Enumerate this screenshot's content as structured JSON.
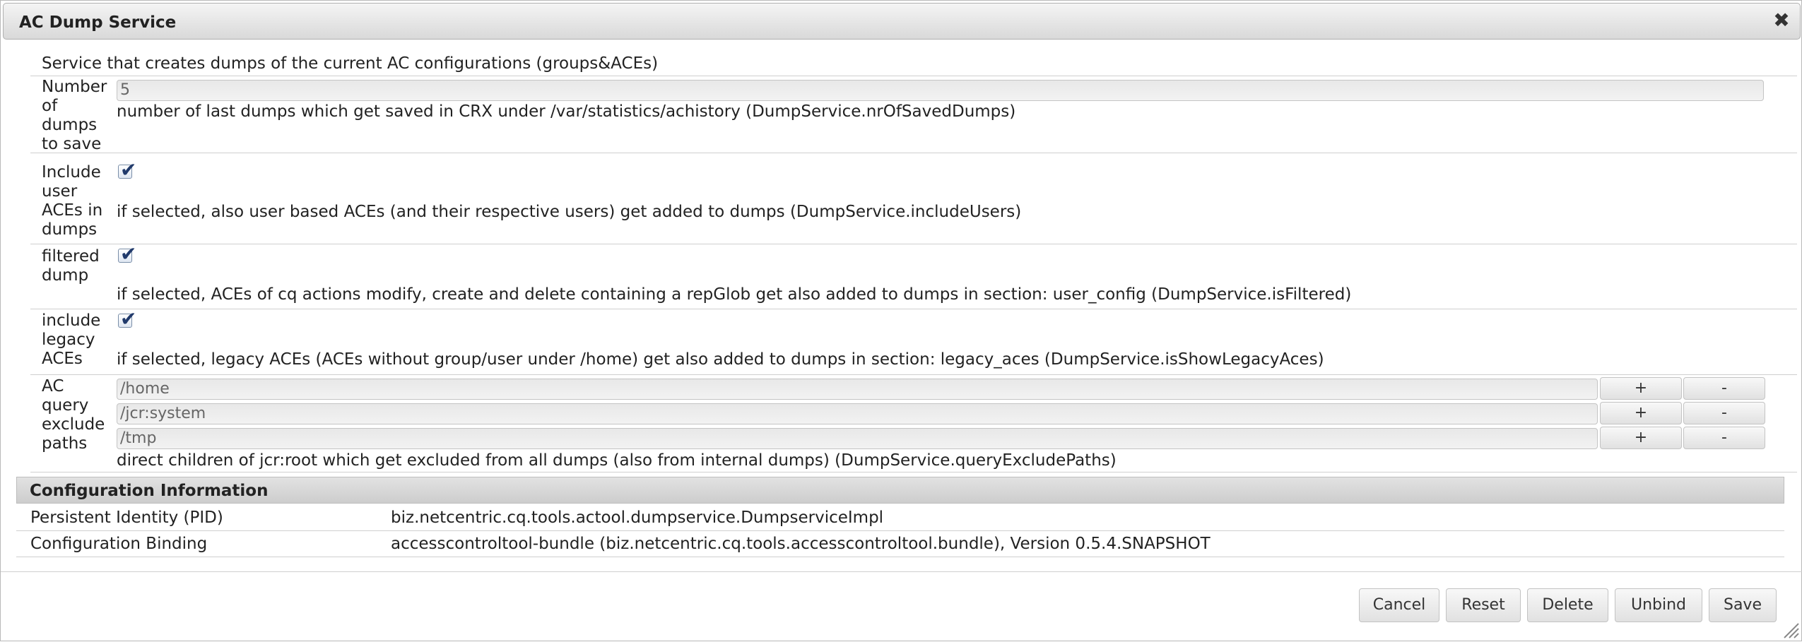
{
  "dialog": {
    "title": "AC Dump Service",
    "close_icon": "close-icon"
  },
  "description": "Service that creates dumps of the current AC configurations (groups&ACEs)",
  "fields": {
    "nr_dumps": {
      "label_lines": [
        "Number",
        "of",
        "dumps",
        "to save"
      ],
      "value": "5",
      "help": "number of last dumps which get saved in CRX under /var/statistics/achistory (DumpService.nrOfSavedDumps)"
    },
    "include_users": {
      "label_lines": [
        "Include",
        "user",
        "ACEs in",
        "dumps"
      ],
      "checked": true,
      "help": "if selected, also user based ACEs (and their respective users) get added to dumps (DumpService.includeUsers)"
    },
    "filtered": {
      "label_lines": [
        "filtered",
        "dump"
      ],
      "checked": true,
      "help": "if selected, ACEs of cq actions modify, create and delete containing a repGlob get also added to dumps in section: user_config (DumpService.isFiltered)"
    },
    "legacy": {
      "label_lines": [
        "include",
        "legacy",
        "ACEs"
      ],
      "checked": true,
      "help": "if selected, legacy ACEs (ACEs without group/user under /home) get also added to dumps in section: legacy_aces (DumpService.isShowLegacyAces)"
    },
    "exclude_paths": {
      "label_lines": [
        "AC",
        "query",
        "exclude",
        "paths"
      ],
      "values": [
        "/home",
        "/jcr:system",
        "/tmp"
      ],
      "add_label": "+",
      "remove_label": "-",
      "help": "direct children of jcr:root which get excluded from all dumps (also from internal dumps) (DumpService.queryExcludePaths)"
    }
  },
  "config_info": {
    "header": "Configuration Information",
    "pid_label": "Persistent Identity (PID)",
    "pid_value": "biz.netcentric.cq.tools.actool.dumpservice.DumpserviceImpl",
    "binding_label": "Configuration Binding",
    "binding_value": "accesscontroltool-bundle (biz.netcentric.cq.tools.accesscontroltool.bundle), Version 0.5.4.SNAPSHOT"
  },
  "buttons": {
    "cancel": "Cancel",
    "reset": "Reset",
    "delete": "Delete",
    "unbind": "Unbind",
    "save": "Save"
  }
}
